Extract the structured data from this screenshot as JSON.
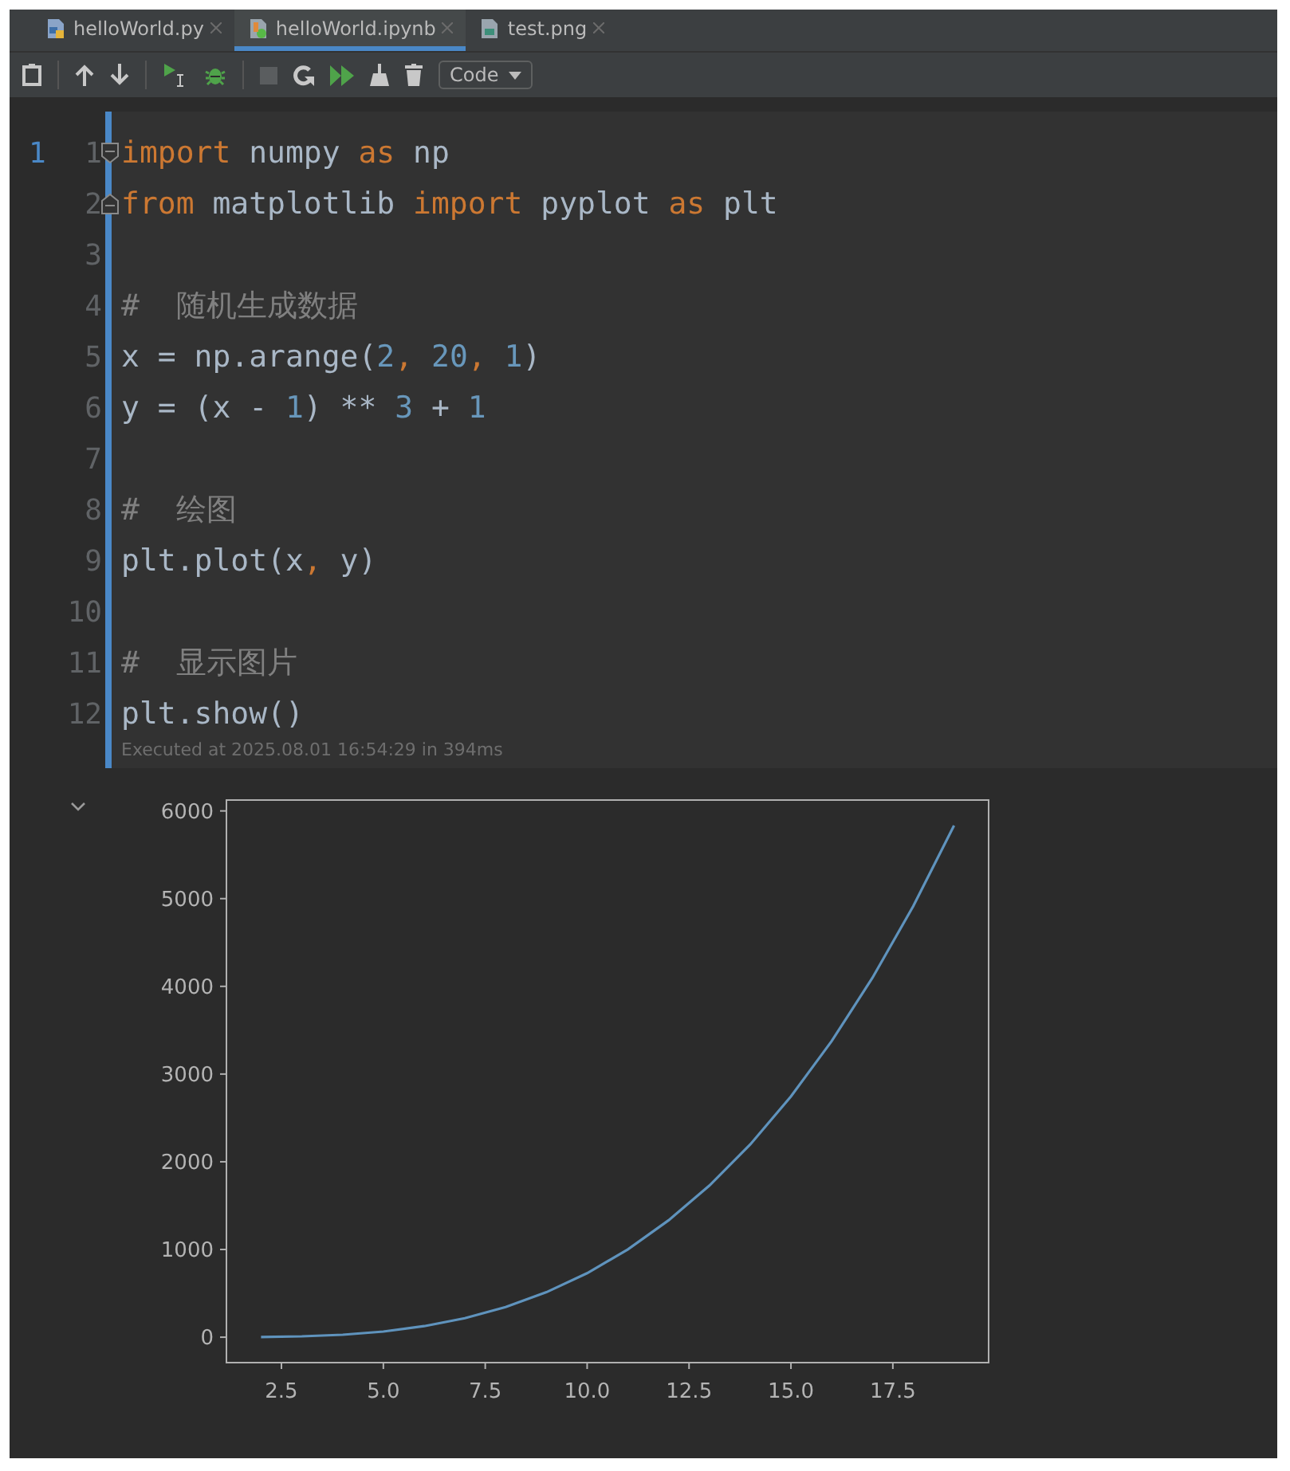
{
  "tabs": [
    {
      "label": "helloWorld.py",
      "kind": "python",
      "selected": false
    },
    {
      "label": "helloWorld.ipynb",
      "kind": "notebook",
      "selected": true
    },
    {
      "label": "test.png",
      "kind": "image",
      "selected": false
    }
  ],
  "toolbar": {
    "cell_type": "Code"
  },
  "cell": {
    "execution_count": "1",
    "lines": [
      {
        "number": "1",
        "fold_start": true,
        "tokens": [
          {
            "text": "import",
            "kind": "keyword"
          },
          {
            "text": " numpy ",
            "kind": "plain"
          },
          {
            "text": "as",
            "kind": "keyword"
          },
          {
            "text": " np",
            "kind": "plain"
          }
        ]
      },
      {
        "number": "2",
        "fold_end": true,
        "tokens": [
          {
            "text": "from",
            "kind": "keyword"
          },
          {
            "text": " matplotlib ",
            "kind": "plain"
          },
          {
            "text": "import",
            "kind": "keyword"
          },
          {
            "text": " pyplot ",
            "kind": "plain"
          },
          {
            "text": "as",
            "kind": "keyword"
          },
          {
            "text": " plt",
            "kind": "plain"
          }
        ]
      },
      {
        "number": "3"
      },
      {
        "number": "4",
        "tokens": [
          {
            "text": "#  随机生成数据",
            "kind": "comment"
          }
        ]
      },
      {
        "number": "5",
        "tokens": [
          {
            "text": "x = np.arange(",
            "kind": "plain"
          },
          {
            "text": "2",
            "kind": "number"
          },
          {
            "text": ", ",
            "kind": "punct"
          },
          {
            "text": "20",
            "kind": "number"
          },
          {
            "text": ", ",
            "kind": "punct"
          },
          {
            "text": "1",
            "kind": "number"
          },
          {
            "text": ")",
            "kind": "plain"
          }
        ]
      },
      {
        "number": "6",
        "tokens": [
          {
            "text": "y = (x - ",
            "kind": "plain"
          },
          {
            "text": "1",
            "kind": "number"
          },
          {
            "text": ") ** ",
            "kind": "plain"
          },
          {
            "text": "3",
            "kind": "number"
          },
          {
            "text": " + ",
            "kind": "plain"
          },
          {
            "text": "1",
            "kind": "number"
          }
        ]
      },
      {
        "number": "7"
      },
      {
        "number": "8",
        "tokens": [
          {
            "text": "#  绘图",
            "kind": "comment"
          }
        ]
      },
      {
        "number": "9",
        "tokens": [
          {
            "text": "plt.plot(x",
            "kind": "plain"
          },
          {
            "text": ",",
            "kind": "punct"
          },
          {
            "text": " y)",
            "kind": "plain"
          }
        ]
      },
      {
        "number": "10"
      },
      {
        "number": "11",
        "tokens": [
          {
            "text": "#  显示图片",
            "kind": "comment"
          }
        ]
      },
      {
        "number": "12",
        "tokens": [
          {
            "text": "plt.show()",
            "kind": "plain"
          }
        ]
      }
    ],
    "status": "Executed at 2025.08.01 16:54:29 in 394ms"
  },
  "output": {
    "chart_data": {
      "type": "line",
      "x": [
        2,
        3,
        4,
        5,
        6,
        7,
        8,
        9,
        10,
        11,
        12,
        13,
        14,
        15,
        16,
        17,
        18,
        19
      ],
      "series": [
        {
          "color": "#5f93bd",
          "values": [
            2,
            9,
            28,
            65,
            126,
            217,
            344,
            513,
            730,
            1001,
            1332,
            1729,
            2198,
            2745,
            3376,
            4097,
            4914,
            5833
          ]
        }
      ],
      "xlim": [
        1.15,
        19.85
      ],
      "ylim": [
        -290,
        6124
      ],
      "xticks": [
        {
          "value": 2.5,
          "label": "2.5"
        },
        {
          "value": 5,
          "label": "5.0"
        },
        {
          "value": 7.5,
          "label": "7.5"
        },
        {
          "value": 10,
          "label": "10.0"
        },
        {
          "value": 12.5,
          "label": "12.5"
        },
        {
          "value": 15,
          "label": "15.0"
        },
        {
          "value": 17.5,
          "label": "17.5"
        }
      ],
      "yticks": [
        0,
        1000,
        2000,
        3000,
        4000,
        5000,
        6000
      ]
    }
  }
}
